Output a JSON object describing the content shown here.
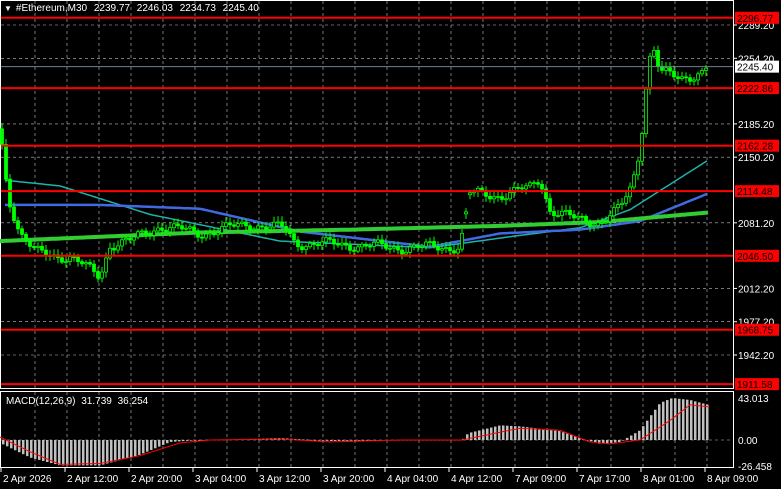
{
  "header": {
    "symbol": "#Ethereum,M30",
    "open": "2239.77",
    "high": "2246.03",
    "low": "2234.73",
    "close": "2245.40",
    "menu_icon": "triangle-down-icon"
  },
  "macd": {
    "label": "MACD(12,26,9)",
    "main": "31.739",
    "signal": "36.254"
  },
  "colors": {
    "background": "#000000",
    "candles": "#00ff00",
    "level": "#ff0000",
    "ma_slow": "#32cd32",
    "ma_mid": "#4169e1",
    "ma_fast": "#20b2aa",
    "histogram": "#c0c0c0",
    "signal": "#ff0000",
    "grid": "#c0c0c0"
  },
  "chart_data": {
    "type": "candlestick",
    "price_ticks": [
      "2289.20",
      "2254.20",
      "2185.20",
      "2150.20",
      "2081.20",
      "2012.20",
      "1977.20",
      "1942.20"
    ],
    "current_price": "2245.40",
    "levels": [
      "2296.77",
      "2222.86",
      "2162.28",
      "2114.48",
      "2046.50",
      "1968.75",
      "1911.58"
    ],
    "time_labels": [
      "2 Apr 2026",
      "2 Apr 12:00",
      "2 Apr 20:00",
      "3 Apr 04:00",
      "3 Apr 12:00",
      "3 Apr 20:00",
      "4 Apr 04:00",
      "4 Apr 12:00",
      "7 Apr 09:00",
      "7 Apr 17:00",
      "8 Apr 01:00",
      "8 Apr 09:00"
    ],
    "price_path": [
      [
        0,
        2180
      ],
      [
        8,
        2110
      ],
      [
        20,
        2070
      ],
      [
        35,
        2050
      ],
      [
        70,
        2045
      ],
      [
        85,
        2035
      ],
      [
        100,
        2025
      ],
      [
        110,
        2058
      ],
      [
        130,
        2062
      ],
      [
        160,
        2078
      ],
      [
        200,
        2070
      ],
      [
        250,
        2080
      ],
      [
        285,
        2075
      ],
      [
        295,
        2060
      ],
      [
        350,
        2058
      ],
      [
        400,
        2055
      ],
      [
        460,
        2056
      ],
      [
        470,
        2112
      ],
      [
        500,
        2110
      ],
      [
        530,
        2118
      ],
      [
        540,
        2128
      ],
      [
        550,
        2095
      ],
      [
        575,
        2085
      ],
      [
        600,
        2082
      ],
      [
        620,
        2096
      ],
      [
        632,
        2120
      ],
      [
        640,
        2160
      ],
      [
        646,
        2225
      ],
      [
        652,
        2272
      ],
      [
        660,
        2240
      ],
      [
        680,
        2232
      ],
      [
        700,
        2240
      ],
      [
        708,
        2245
      ]
    ],
    "ma_slow": [
      [
        0,
        2062
      ],
      [
        200,
        2071
      ],
      [
        350,
        2074
      ],
      [
        500,
        2078
      ],
      [
        600,
        2082
      ],
      [
        708,
        2092
      ]
    ],
    "ma_mid": [
      [
        5,
        2100
      ],
      [
        100,
        2100
      ],
      [
        200,
        2096
      ],
      [
        300,
        2072
      ],
      [
        430,
        2056
      ],
      [
        500,
        2070
      ],
      [
        580,
        2074
      ],
      [
        640,
        2083
      ],
      [
        708,
        2112
      ]
    ],
    "ma_fast": [
      [
        5,
        2126
      ],
      [
        60,
        2120
      ],
      [
        150,
        2090
      ],
      [
        280,
        2062
      ],
      [
        430,
        2055
      ],
      [
        520,
        2068
      ],
      [
        580,
        2076
      ],
      [
        630,
        2095
      ],
      [
        708,
        2147
      ]
    ],
    "macd_ticks": [
      "43.013",
      "0.00",
      "-26.458"
    ],
    "macd_hist": [
      [
        0,
        -3
      ],
      [
        30,
        -18
      ],
      [
        60,
        -26
      ],
      [
        100,
        -26
      ],
      [
        140,
        -15
      ],
      [
        170,
        -2
      ],
      [
        200,
        0
      ],
      [
        250,
        1
      ],
      [
        280,
        2
      ],
      [
        330,
        -1
      ],
      [
        400,
        0
      ],
      [
        462,
        0
      ],
      [
        468,
        7
      ],
      [
        500,
        15
      ],
      [
        520,
        14
      ],
      [
        560,
        9
      ],
      [
        580,
        2
      ],
      [
        600,
        -4
      ],
      [
        620,
        -2
      ],
      [
        640,
        10
      ],
      [
        660,
        38
      ],
      [
        672,
        43
      ],
      [
        690,
        41
      ],
      [
        708,
        36
      ]
    ],
    "macd_signal": [
      [
        0,
        3
      ],
      [
        30,
        -12
      ],
      [
        60,
        -25
      ],
      [
        100,
        -24
      ],
      [
        140,
        -16
      ],
      [
        180,
        -3
      ],
      [
        210,
        0
      ],
      [
        280,
        1
      ],
      [
        330,
        -2
      ],
      [
        400,
        0
      ],
      [
        462,
        0
      ],
      [
        500,
        8
      ],
      [
        520,
        12
      ],
      [
        560,
        10
      ],
      [
        590,
        -2
      ],
      [
        610,
        -4
      ],
      [
        640,
        0
      ],
      [
        670,
        20
      ],
      [
        690,
        36
      ],
      [
        708,
        34
      ]
    ]
  }
}
